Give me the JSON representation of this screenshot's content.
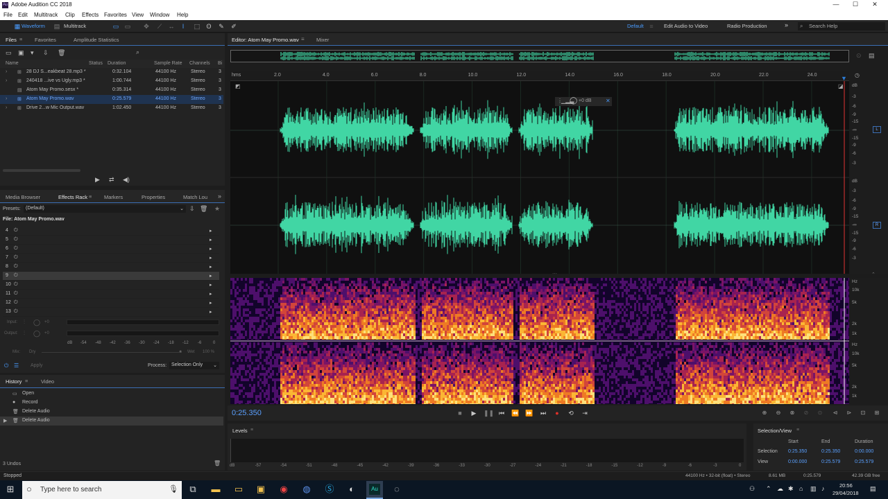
{
  "window": {
    "title": "Adobe Audition CC 2018",
    "app_icon": "Au",
    "minimize": "—",
    "maximize": "☐",
    "close": "✕"
  },
  "menu": [
    "File",
    "Edit",
    "Multitrack",
    "Clip",
    "Effects",
    "Favorites",
    "View",
    "Window",
    "Help"
  ],
  "toolbar": {
    "waveform": "Waveform",
    "multitrack": "Multitrack",
    "workspaces": [
      "Default",
      "Edit Audio to Video",
      "Radio Production"
    ],
    "more": "»",
    "search_placeholder": "Search Help"
  },
  "files_panel": {
    "tabs": [
      "Files",
      "Favorites",
      "Amplitude Statistics"
    ],
    "columns": [
      "Name",
      "Status",
      "Duration",
      "Sample Rate",
      "Channels",
      "Bi"
    ],
    "rows": [
      {
        "name": "28 DJ S...eakbeat 28.mp3 *",
        "duration": "0:32.104",
        "rate": "44100 Hz",
        "channels": "Stereo",
        "bits": "3"
      },
      {
        "name": "240418 ...ive vs Ugly.mp3 *",
        "duration": "1:00.744",
        "rate": "44100 Hz",
        "channels": "Stereo",
        "bits": "3"
      },
      {
        "name": "Atom May Promo.sesx *",
        "duration": "0:35.314",
        "rate": "44100 Hz",
        "channels": "Stereo",
        "bits": "3"
      },
      {
        "name": "Atom May Promo.wav",
        "duration": "0:25.579",
        "rate": "44100 Hz",
        "channels": "Stereo",
        "bits": "3"
      },
      {
        "name": "Drive 2...w Mic Output.wav",
        "duration": "1:02.450",
        "rate": "44100 Hz",
        "channels": "Stereo",
        "bits": "3"
      }
    ]
  },
  "effects_panel": {
    "tabs": [
      "Media Browser",
      "Effects Rack",
      "Markers",
      "Properties",
      "Match Lou"
    ],
    "presets_label": "Presets:",
    "preset_value": "(Default)",
    "file_label": "File: Atom May Promo.wav",
    "slots": [
      "4",
      "5",
      "6",
      "7",
      "8",
      "9",
      "10",
      "11",
      "12",
      "13"
    ],
    "input_label": "Input:",
    "output_label": "Output:",
    "input_value": "+0",
    "output_value": "+0",
    "meter_scale": [
      "dB",
      "-54",
      "-48",
      "-42",
      "-36",
      "-30",
      "-24",
      "-18",
      "-12",
      "-6",
      "0"
    ],
    "mix_label": "Mix:",
    "dry_label": "Dry",
    "wet_label": "Wet",
    "wet_value": "100 %",
    "apply_label": "Apply",
    "process_label": "Process:",
    "process_value": "Selection Only"
  },
  "history_panel": {
    "tabs": [
      "History",
      "Video"
    ],
    "items": [
      "Open",
      "Record",
      "Delete Audio",
      "Delete Audio"
    ],
    "undos": "3 Undos"
  },
  "editor": {
    "tab": "Editor: Atom May Promo.wav",
    "mixer_tab": "Mixer",
    "ruler_unit": "hms",
    "ruler": [
      "2.0",
      "4.0",
      "6.0",
      "8.0",
      "10.0",
      "12.0",
      "14.0",
      "16.0",
      "18.0",
      "20.0",
      "22.0",
      "24.0"
    ],
    "hud_value": "+0 dB",
    "db_scale_top": [
      "dB",
      "-3",
      "-6",
      "-9",
      "-15",
      "-∞",
      "-15",
      "-9",
      "-6",
      "-3"
    ],
    "db_scale_bottom": [
      "dB",
      "-3",
      "-6",
      "-9",
      "-15",
      "-∞",
      "-15",
      "-9",
      "-6",
      "-3"
    ],
    "channel_l": "L",
    "channel_r": "R",
    "spec_scale": [
      "Hz",
      "10k",
      "5k",
      "2k",
      "1k"
    ],
    "time": "0:25.350",
    "waveform_color": "#41d6a4",
    "playhead_color": "#e33333"
  },
  "levels": {
    "title": "Levels",
    "scale": [
      "dB",
      "-57",
      "-54",
      "-51",
      "-48",
      "-45",
      "-42",
      "-39",
      "-36",
      "-33",
      "-30",
      "-27",
      "-24",
      "-21",
      "-18",
      "-15",
      "-12",
      "-9",
      "-6",
      "-3",
      "0"
    ]
  },
  "selection_view": {
    "title": "Selection/View",
    "headers": [
      "Start",
      "End",
      "Duration"
    ],
    "selection_label": "Selection",
    "view_label": "View",
    "selection": [
      "0:25.350",
      "0:25.350",
      "0:00.000"
    ],
    "view": [
      "0:00.000",
      "0:25.579",
      "0:25.579"
    ]
  },
  "status": {
    "left": "Stopped",
    "format": "44100 Hz • 32-bit (float) • Stereo",
    "size": "8.61 MB",
    "duration": "0:25.579",
    "free": "42.39 GB free"
  },
  "taskbar": {
    "search": "Type here to search",
    "time": "20:56",
    "date": "29/04/2018"
  }
}
